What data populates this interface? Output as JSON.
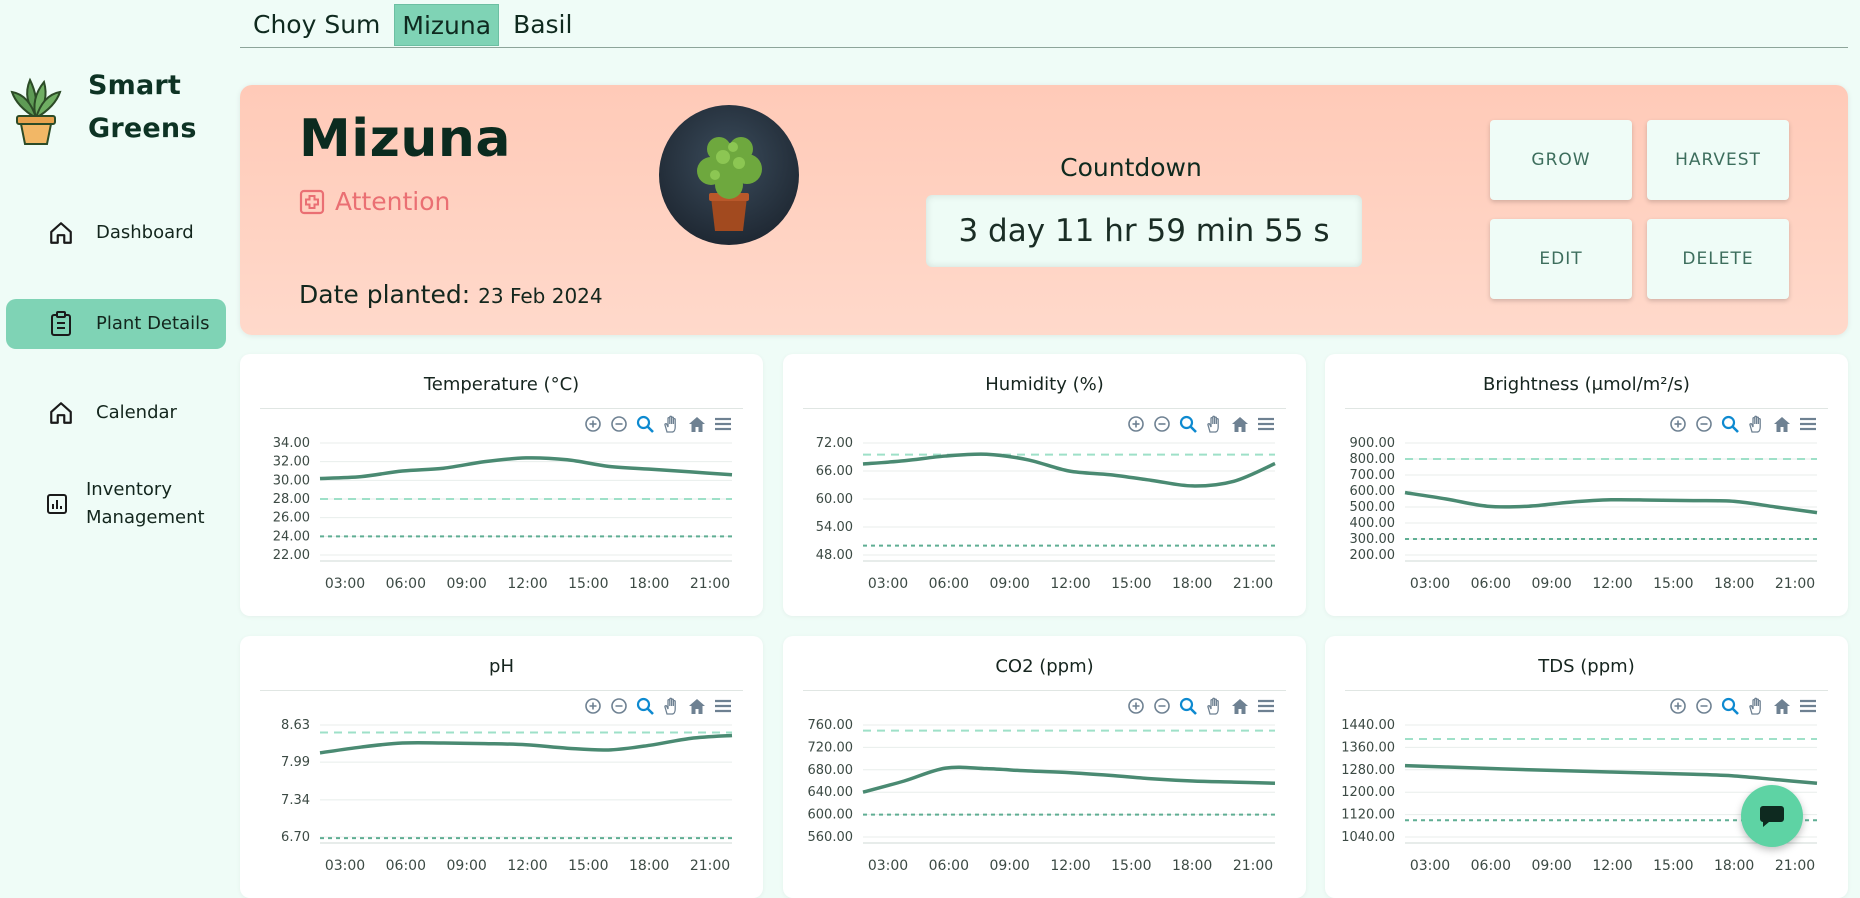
{
  "brand": {
    "line1": "Smart",
    "line2": "Greens"
  },
  "nav": [
    {
      "label": "Dashboard",
      "icon": "home-icon"
    },
    {
      "label": "Plant Details",
      "icon": "clipboard-icon"
    },
    {
      "label": "Calendar",
      "icon": "home-icon"
    },
    {
      "label": "Inventory Management",
      "icon": "bar-chart-icon"
    }
  ],
  "tabs": [
    "Choy Sum",
    "Mizuna",
    "Basil"
  ],
  "active_tab": "Mizuna",
  "plant": {
    "name": "Mizuna",
    "status": "Attention",
    "date_label": "Date planted:",
    "date_value": "23 Feb 2024",
    "countdown_label": "Countdown",
    "countdown_value": "3 day 11 hr 59 min 55 s"
  },
  "actions": [
    "GROW",
    "HARVEST",
    "EDIT",
    "DELETE"
  ],
  "colors": {
    "accent": "#7fd3b5",
    "line": "#4a8a72",
    "upper": "#9ee0c8",
    "lower": "#5fae93",
    "status": "#ea6f73"
  },
  "chart_data": [
    {
      "type": "line",
      "title": "Temperature (°C)",
      "x": [
        "03:00",
        "06:00",
        "09:00",
        "12:00",
        "15:00",
        "18:00",
        "21:00"
      ],
      "yticks": [
        "34.00",
        "32.00",
        "30.00",
        "28.00",
        "26.00",
        "24.00",
        "22.00"
      ],
      "ylim": [
        22,
        34
      ],
      "values": [
        30.2,
        30.4,
        31.0,
        31.3,
        32.0,
        32.4,
        32.2,
        31.5,
        31.2,
        30.9,
        30.6
      ],
      "upper": 28,
      "lower": 24
    },
    {
      "type": "line",
      "title": "Humidity (%)",
      "x": [
        "03:00",
        "06:00",
        "09:00",
        "12:00",
        "15:00",
        "18:00",
        "21:00"
      ],
      "yticks": [
        "72.00",
        "66.00",
        "60.00",
        "54.00",
        "48.00"
      ],
      "ylim": [
        48,
        72
      ],
      "values": [
        67.5,
        68.2,
        69.2,
        69.6,
        68.4,
        66.0,
        65.2,
        64.0,
        62.8,
        63.8,
        67.6
      ],
      "upper": 69.5,
      "lower": 50
    },
    {
      "type": "line",
      "title": "Brightness (μmol/m²/s)",
      "x": [
        "03:00",
        "06:00",
        "09:00",
        "12:00",
        "15:00",
        "18:00",
        "21:00"
      ],
      "yticks": [
        "900.00",
        "800.00",
        "700.00",
        "600.00",
        "500.00",
        "400.00",
        "300.00",
        "200.00"
      ],
      "ylim": [
        200,
        900
      ],
      "values": [
        590,
        550,
        505,
        505,
        530,
        545,
        543,
        540,
        535,
        500,
        465
      ],
      "upper": 800,
      "lower": 300
    },
    {
      "type": "line",
      "title": "pH",
      "x": [
        "03:00",
        "06:00",
        "09:00",
        "12:00",
        "15:00",
        "18:00",
        "21:00"
      ],
      "yticks": [
        "8.63",
        "7.99",
        "7.34",
        "6.70"
      ],
      "ylim": [
        6.7,
        8.63
      ],
      "values": [
        8.15,
        8.25,
        8.32,
        8.32,
        8.31,
        8.29,
        8.23,
        8.2,
        8.28,
        8.4,
        8.45
      ],
      "upper": 8.5,
      "lower": 6.68
    },
    {
      "type": "line",
      "title": "CO2 (ppm)",
      "x": [
        "03:00",
        "06:00",
        "09:00",
        "12:00",
        "15:00",
        "18:00",
        "21:00"
      ],
      "yticks": [
        "760.00",
        "720.00",
        "680.00",
        "640.00",
        "600.00",
        "560.00"
      ],
      "ylim": [
        560,
        760
      ],
      "values": [
        640,
        660,
        683,
        682,
        678,
        675,
        670,
        664,
        660,
        658,
        656
      ],
      "upper": 750,
      "lower": 600
    },
    {
      "type": "line",
      "title": "TDS (ppm)",
      "x": [
        "03:00",
        "06:00",
        "09:00",
        "12:00",
        "15:00",
        "18:00",
        "21:00"
      ],
      "yticks": [
        "1440.00",
        "1360.00",
        "1280.00",
        "1200.00",
        "1120.00",
        "1040.00"
      ],
      "ylim": [
        1040,
        1440
      ],
      "values": [
        1295,
        1290,
        1285,
        1280,
        1276,
        1272,
        1268,
        1264,
        1258,
        1245,
        1232
      ],
      "upper": 1390,
      "lower": 1100
    }
  ]
}
